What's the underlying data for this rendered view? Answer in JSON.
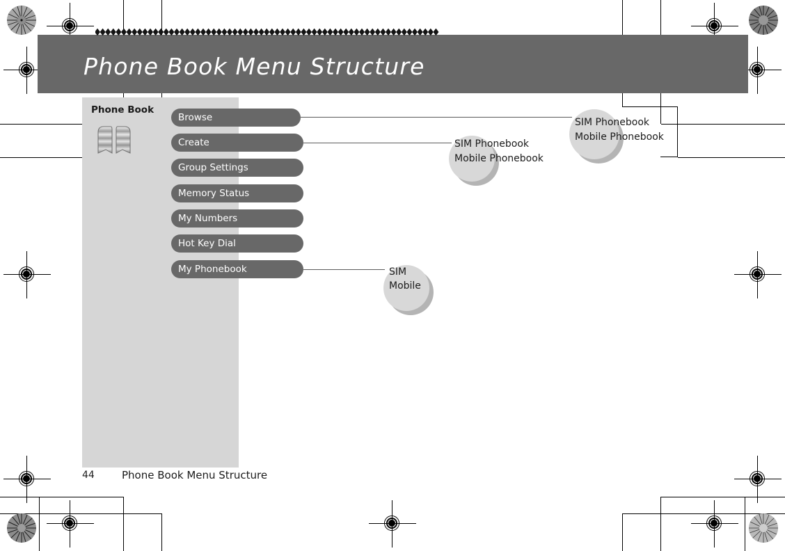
{
  "page": {
    "title": "Phone Book Menu Structure",
    "footer_page_number": "44",
    "footer_title": "Phone Book Menu Structure",
    "colors": {
      "header_gray": "#686868",
      "panel_gray": "#d6d6d6",
      "pill_gray": "#686868",
      "bubble_gray": "#d8d8d8",
      "bubble_shadow": "#b4b4b4",
      "connector": "#5a5a5a",
      "text_light": "#ffffff",
      "text_dark": "#1a1a1a"
    }
  },
  "panel": {
    "label": "Phone Book",
    "icon": "open-book-icon"
  },
  "menu": {
    "items": [
      {
        "label": "Browse",
        "has_connector": true
      },
      {
        "label": "Create",
        "has_connector": true
      },
      {
        "label": "Group Settings",
        "has_connector": false
      },
      {
        "label": "Memory Status",
        "has_connector": false
      },
      {
        "label": "My Numbers",
        "has_connector": false
      },
      {
        "label": "Hot Key Dial",
        "has_connector": false
      },
      {
        "label": "My Phonebook",
        "has_connector": true
      }
    ]
  },
  "bubbles": [
    {
      "source": "Browse",
      "line1": "SIM Phonebook",
      "line2": "Mobile Phonebook"
    },
    {
      "source": "Create",
      "line1": "SIM Phonebook",
      "line2": "Mobile Phonebook"
    },
    {
      "source": "My Phonebook",
      "line1": "SIM",
      "line2": "Mobile"
    }
  ]
}
